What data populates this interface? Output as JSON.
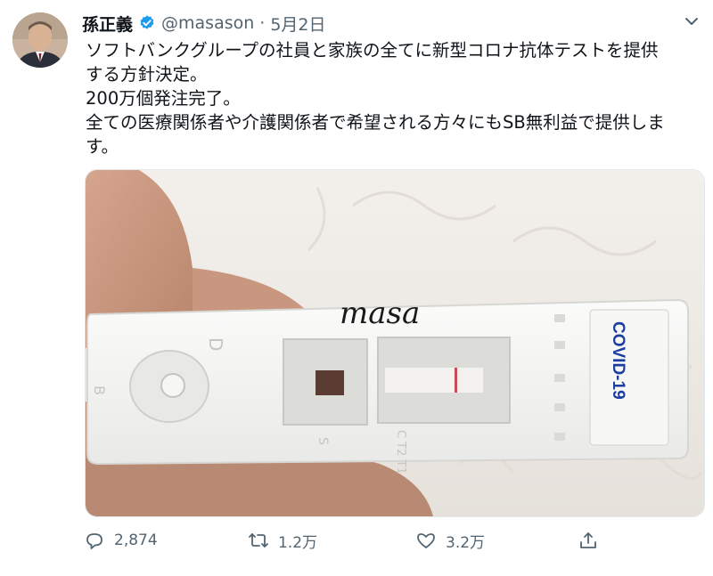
{
  "tweet": {
    "author_name": "孫正義",
    "handle": "@masason",
    "separator": "·",
    "date": "5月2日",
    "lines": [
      "ソフトバンクグループの社員と家族の全てに新型コロナ抗体テストを提供",
      "する方針決定。",
      "200万個発注完了。",
      "全ての医療関係者や介護関係者で希望される方々にもSB無利益で提供しま",
      "す。"
    ]
  },
  "media": {
    "handwritten_text": "masa",
    "cassette_label": "COVID-19",
    "letter_D": "D",
    "letter_B": "B",
    "letter_S": "S",
    "letters_right": "C T2 T1"
  },
  "actions": {
    "reply_count": "2,874",
    "retweet_count": "1.2万",
    "like_count": "3.2万"
  },
  "colors": {
    "verified": "#1d9bf0",
    "text": "#0f1419",
    "muted": "#536471",
    "cassette_text": "#1a3fa0"
  },
  "icons": [
    "verified-badge-icon",
    "chevron-down-icon",
    "reply-icon",
    "retweet-icon",
    "like-icon",
    "share-icon"
  ]
}
